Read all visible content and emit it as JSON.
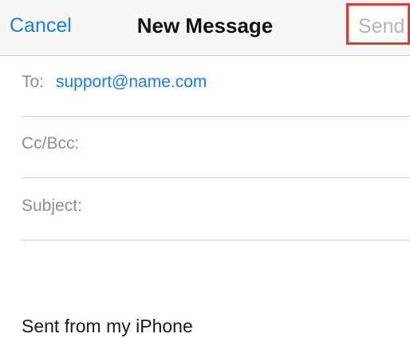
{
  "nav": {
    "cancel_label": "Cancel",
    "title": "New Message",
    "send_label": "Send"
  },
  "fields": {
    "to": {
      "label": "To:",
      "value": "support@name.com"
    },
    "cc_bcc": {
      "label": "Cc/Bcc:"
    },
    "subject": {
      "label": "Subject:"
    }
  },
  "body": {
    "signature": "Sent from my iPhone"
  },
  "colors": {
    "accent": "#1a7cf0",
    "send_disabled": "#b4b4b8",
    "highlight_box": "#e43a2b",
    "label_gray": "#8d8d92"
  }
}
